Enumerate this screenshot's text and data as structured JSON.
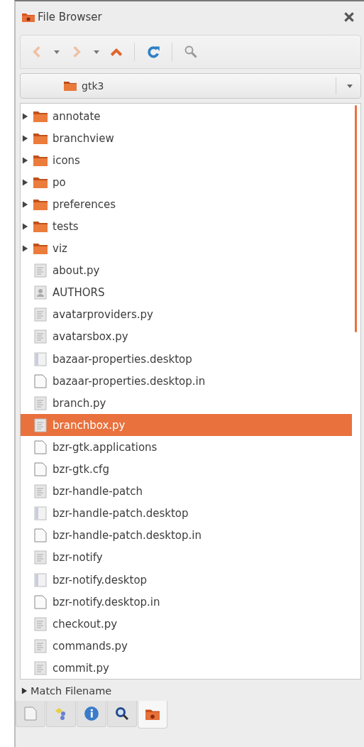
{
  "panel": {
    "title": "File Browser"
  },
  "toolbar": [
    [
      {
        "kind": "back",
        "disabled": true
      },
      {
        "kind": "dropdown",
        "disabled": false
      },
      {
        "kind": "forward",
        "disabled": true
      },
      {
        "kind": "dropdown",
        "disabled": false
      },
      {
        "kind": "up",
        "disabled": false
      }
    ],
    [
      {
        "kind": "refresh",
        "disabled": false
      }
    ],
    [
      {
        "kind": "filter",
        "disabled": false
      }
    ]
  ],
  "location": {
    "value": "gtk3"
  },
  "files": [
    {
      "name": "annotate",
      "kind": "folder",
      "expanded": false,
      "selected": false
    },
    {
      "name": "branchview",
      "kind": "folder",
      "expanded": false,
      "selected": false
    },
    {
      "name": "icons",
      "kind": "folder",
      "expanded": false,
      "selected": false
    },
    {
      "name": "po",
      "kind": "folder",
      "expanded": false,
      "selected": false
    },
    {
      "name": "preferences",
      "kind": "folder",
      "expanded": false,
      "selected": false
    },
    {
      "name": "tests",
      "kind": "folder",
      "expanded": false,
      "selected": false
    },
    {
      "name": "viz",
      "kind": "folder",
      "expanded": false,
      "selected": false
    },
    {
      "name": "about.py",
      "kind": "script",
      "selected": false
    },
    {
      "name": "AUTHORS",
      "kind": "text",
      "selected": false
    },
    {
      "name": "avatarproviders.py",
      "kind": "script",
      "selected": false
    },
    {
      "name": "avatarsbox.py",
      "kind": "script",
      "selected": false
    },
    {
      "name": "bazaar-properties.desktop",
      "kind": "desktop",
      "selected": false
    },
    {
      "name": "bazaar-properties.desktop.in",
      "kind": "plain",
      "selected": false
    },
    {
      "name": "branch.py",
      "kind": "script",
      "selected": false
    },
    {
      "name": "branchbox.py",
      "kind": "script",
      "selected": true
    },
    {
      "name": "bzr-gtk.applications",
      "kind": "plain",
      "selected": false
    },
    {
      "name": "bzr-gtk.cfg",
      "kind": "plain",
      "selected": false
    },
    {
      "name": "bzr-handle-patch",
      "kind": "script",
      "selected": false
    },
    {
      "name": "bzr-handle-patch.desktop",
      "kind": "desktop",
      "selected": false
    },
    {
      "name": "bzr-handle-patch.desktop.in",
      "kind": "plain",
      "selected": false
    },
    {
      "name": "bzr-notify",
      "kind": "script",
      "selected": false
    },
    {
      "name": "bzr-notify.desktop",
      "kind": "desktop",
      "selected": false
    },
    {
      "name": "bzr-notify.desktop.in",
      "kind": "plain",
      "selected": false
    },
    {
      "name": "checkout.py",
      "kind": "script",
      "selected": false
    },
    {
      "name": "commands.py",
      "kind": "script",
      "selected": false
    },
    {
      "name": "commit.py",
      "kind": "script",
      "selected": false
    }
  ],
  "filter": {
    "label": "Match Filename",
    "expanded": false
  },
  "bottom_tabs": [
    {
      "kind": "documents",
      "selected": false
    },
    {
      "kind": "symbols",
      "selected": false
    },
    {
      "kind": "info",
      "selected": false
    },
    {
      "kind": "search",
      "selected": false
    },
    {
      "kind": "files",
      "selected": true
    }
  ]
}
